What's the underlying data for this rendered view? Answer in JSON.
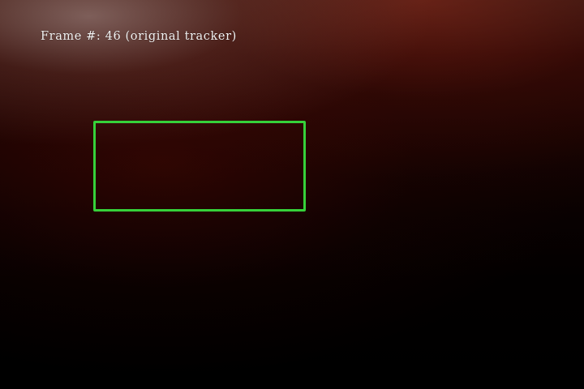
{
  "overlay": {
    "frame_label": "Frame #: 46 (original tracker)"
  },
  "tracker": {
    "box_color": "#36d13a"
  }
}
